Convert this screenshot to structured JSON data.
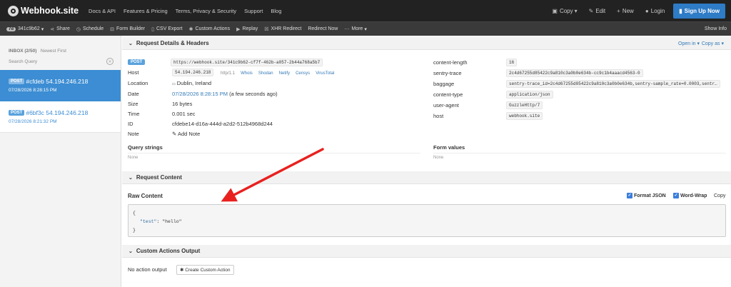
{
  "topbar": {
    "brand": "Webhook.site",
    "nav": [
      "Docs & API",
      "Features & Pricing",
      "Terms, Privacy & Security",
      "Support",
      "Blog"
    ],
    "copy": "Copy",
    "edit": "Edit",
    "new": "New",
    "login": "Login",
    "signup": "Sign Up Now"
  },
  "toolbar": {
    "badge": "7d",
    "token": "341c9b62",
    "items": [
      "Share",
      "Schedule",
      "Form Builder",
      "CSV Export",
      "Custom Actions",
      "Replay",
      "XHR Redirect",
      "Redirect Now",
      "More"
    ],
    "show_info": "Show Info"
  },
  "sidebar": {
    "inbox_label": "INBOX (2/50)",
    "sort_label": "Newest First",
    "search_placeholder": "Search Query",
    "requests": [
      {
        "method": "POST",
        "id": "#cfdeb",
        "ip": "54.194.246.218",
        "time": "07/28/2026 8:28:15 PM"
      },
      {
        "method": "POST",
        "id": "#6bf3c",
        "ip": "54.194.246.218",
        "time": "07/28/2026 8:21:32 PM"
      }
    ]
  },
  "details": {
    "title": "Request Details & Headers",
    "open_in": "Open in",
    "copy_as": "Copy as",
    "method": "POST",
    "url": "https://webhook.site/341c9b62-cf7f-462b-a057-2b44a768a5b7",
    "host_label": "Host",
    "host_value": "54.194.246.218",
    "host_proto": "http/1.1",
    "host_links": [
      "Whois",
      "Shodan",
      "Netify",
      "Censys",
      "VirusTotal"
    ],
    "location_label": "Location",
    "location_value": "Dublin, Ireland",
    "date_label": "Date",
    "date_value": "07/28/2026 8:28:15 PM",
    "date_relative": "(a few seconds ago)",
    "size_label": "Size",
    "size_value": "16 bytes",
    "time_label": "Time",
    "time_value": "0.001 sec",
    "id_label": "ID",
    "id_value": "cfdebe14-d16a-444d-a2d2-512b4968d244",
    "note_label": "Note",
    "note_add": "Add Note",
    "headers": [
      {
        "name": "content-length",
        "value": "16"
      },
      {
        "name": "sentry-trace",
        "value": "2c4d67255d85422c9a810c3a0b0e634b-cc9c1b4aaacd4563-0"
      },
      {
        "name": "baggage",
        "value": "sentry-trace_id=2c4d67255d85422c9a810c3a0b0e634b,sentry-sample_rate=0.0003,sentr…"
      },
      {
        "name": "content-type",
        "value": "application/json"
      },
      {
        "name": "user-agent",
        "value": "GuzzleHttp/7"
      },
      {
        "name": "host",
        "value": "webhook.site"
      }
    ],
    "query_title": "Query strings",
    "query_value": "None",
    "form_title": "Form values",
    "form_value": "None"
  },
  "content": {
    "title": "Request Content",
    "raw_title": "Raw Content",
    "format_json": "Format JSON",
    "word_wrap": "Word-Wrap",
    "copy": "Copy",
    "line1": "{",
    "key": "\"test\"",
    "colon": ": ",
    "value": "\"hello\"",
    "line3": "}"
  },
  "actions": {
    "title": "Custom Actions Output",
    "empty": "No action output",
    "create": "Create Custom Action"
  },
  "colors": {
    "accent": "#3c8dd3",
    "arrow": "#e8211f",
    "navbar": "#222222"
  }
}
